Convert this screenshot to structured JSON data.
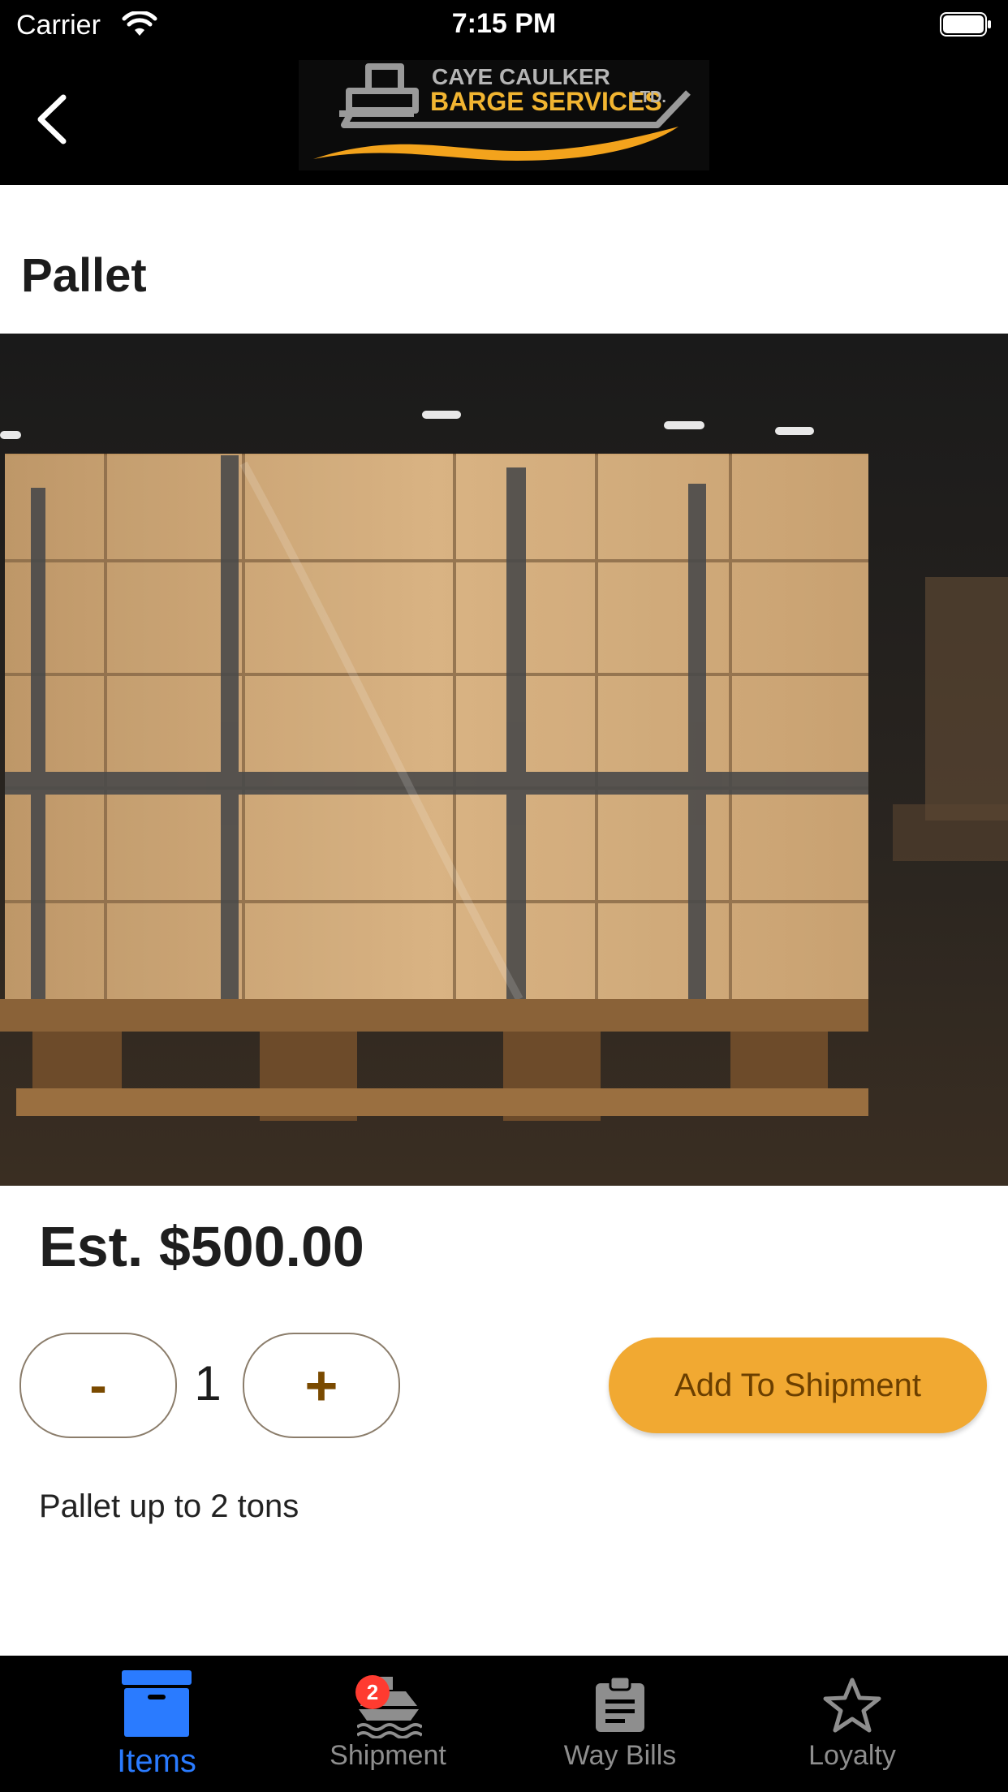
{
  "status_bar": {
    "carrier": "Carrier",
    "time": "7:15 PM",
    "icons": [
      "wifi-icon",
      "battery-icon"
    ]
  },
  "nav": {
    "back_icon": "chevron-left-icon",
    "logo": {
      "line1": "CAYE CAULKER",
      "line2": "BARGE SERVICES",
      "suffix": "LTD."
    }
  },
  "product": {
    "title": "Pallet",
    "image_alt": "shrink-wrapped pallet of cardboard boxes",
    "price": "Est. $500.00",
    "quantity": "1",
    "minus_label": "-",
    "plus_label": "+",
    "add_label": "Add To Shipment",
    "description": "Pallet up to 2 tons"
  },
  "tabs": [
    {
      "label": "Items",
      "icon": "box-icon",
      "active": true
    },
    {
      "label": "Shipment",
      "icon": "ship-icon",
      "badge": "2"
    },
    {
      "label": "Way Bills",
      "icon": "clipboard-icon"
    },
    {
      "label": "Loyalty",
      "icon": "star-icon"
    }
  ],
  "colors": {
    "accent": "#f1a932",
    "active_tab": "#2a7bff",
    "inactive_tab": "#8e8e8e",
    "badge": "#ff3b30",
    "bar_background": "#000000"
  }
}
